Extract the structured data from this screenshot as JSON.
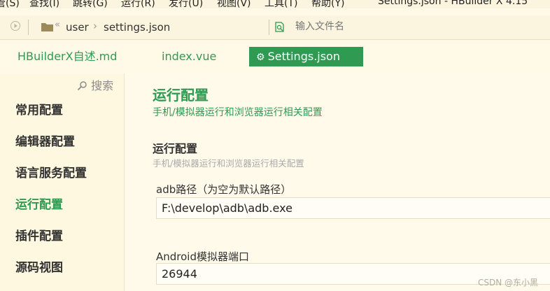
{
  "menubar": {
    "items": [
      "管(S)",
      "查找(I)",
      "跳转(G)",
      "运行(R)",
      "发行(U)",
      "视图(V)",
      "工具(T)",
      "帮助(Y)"
    ],
    "window_title": "Settings.json - HBuilder X 4.15"
  },
  "addressbar": {
    "nav_prefix": "«",
    "path": [
      "user",
      "settings.json"
    ],
    "path_separator": "›",
    "file_input_placeholder": "输入文件名"
  },
  "tabs": [
    {
      "label": "HBuilderX自述.md",
      "active": false
    },
    {
      "label": "index.vue",
      "active": false
    },
    {
      "label": "Settings.json",
      "active": true,
      "icon": "gear-icon"
    }
  ],
  "sidebar": {
    "search_label": "搜索",
    "items": [
      {
        "label": "常用配置",
        "active": false
      },
      {
        "label": "编辑器配置",
        "active": false
      },
      {
        "label": "语言服务配置",
        "active": false
      },
      {
        "label": "运行配置",
        "active": true
      },
      {
        "label": "插件配置",
        "active": false
      },
      {
        "label": "源码视图",
        "active": false
      }
    ]
  },
  "main": {
    "title": "运行配置",
    "subtitle": "手机/模拟器运行和浏览器运行相关配置",
    "section_title": "运行配置",
    "section_desc": "手机/模拟器运行和浏览器运行相关配置",
    "fields": [
      {
        "label": "adb路径（为空为默认路径）",
        "value": "F:\\develop\\adb\\adb.exe"
      },
      {
        "label": "Android模拟器端口",
        "value": "26944"
      }
    ]
  },
  "watermark": "CSDN @东小黑",
  "colors": {
    "accent": "#2f9a52",
    "background": "#fffae8",
    "folder": "#9c8a5a"
  }
}
